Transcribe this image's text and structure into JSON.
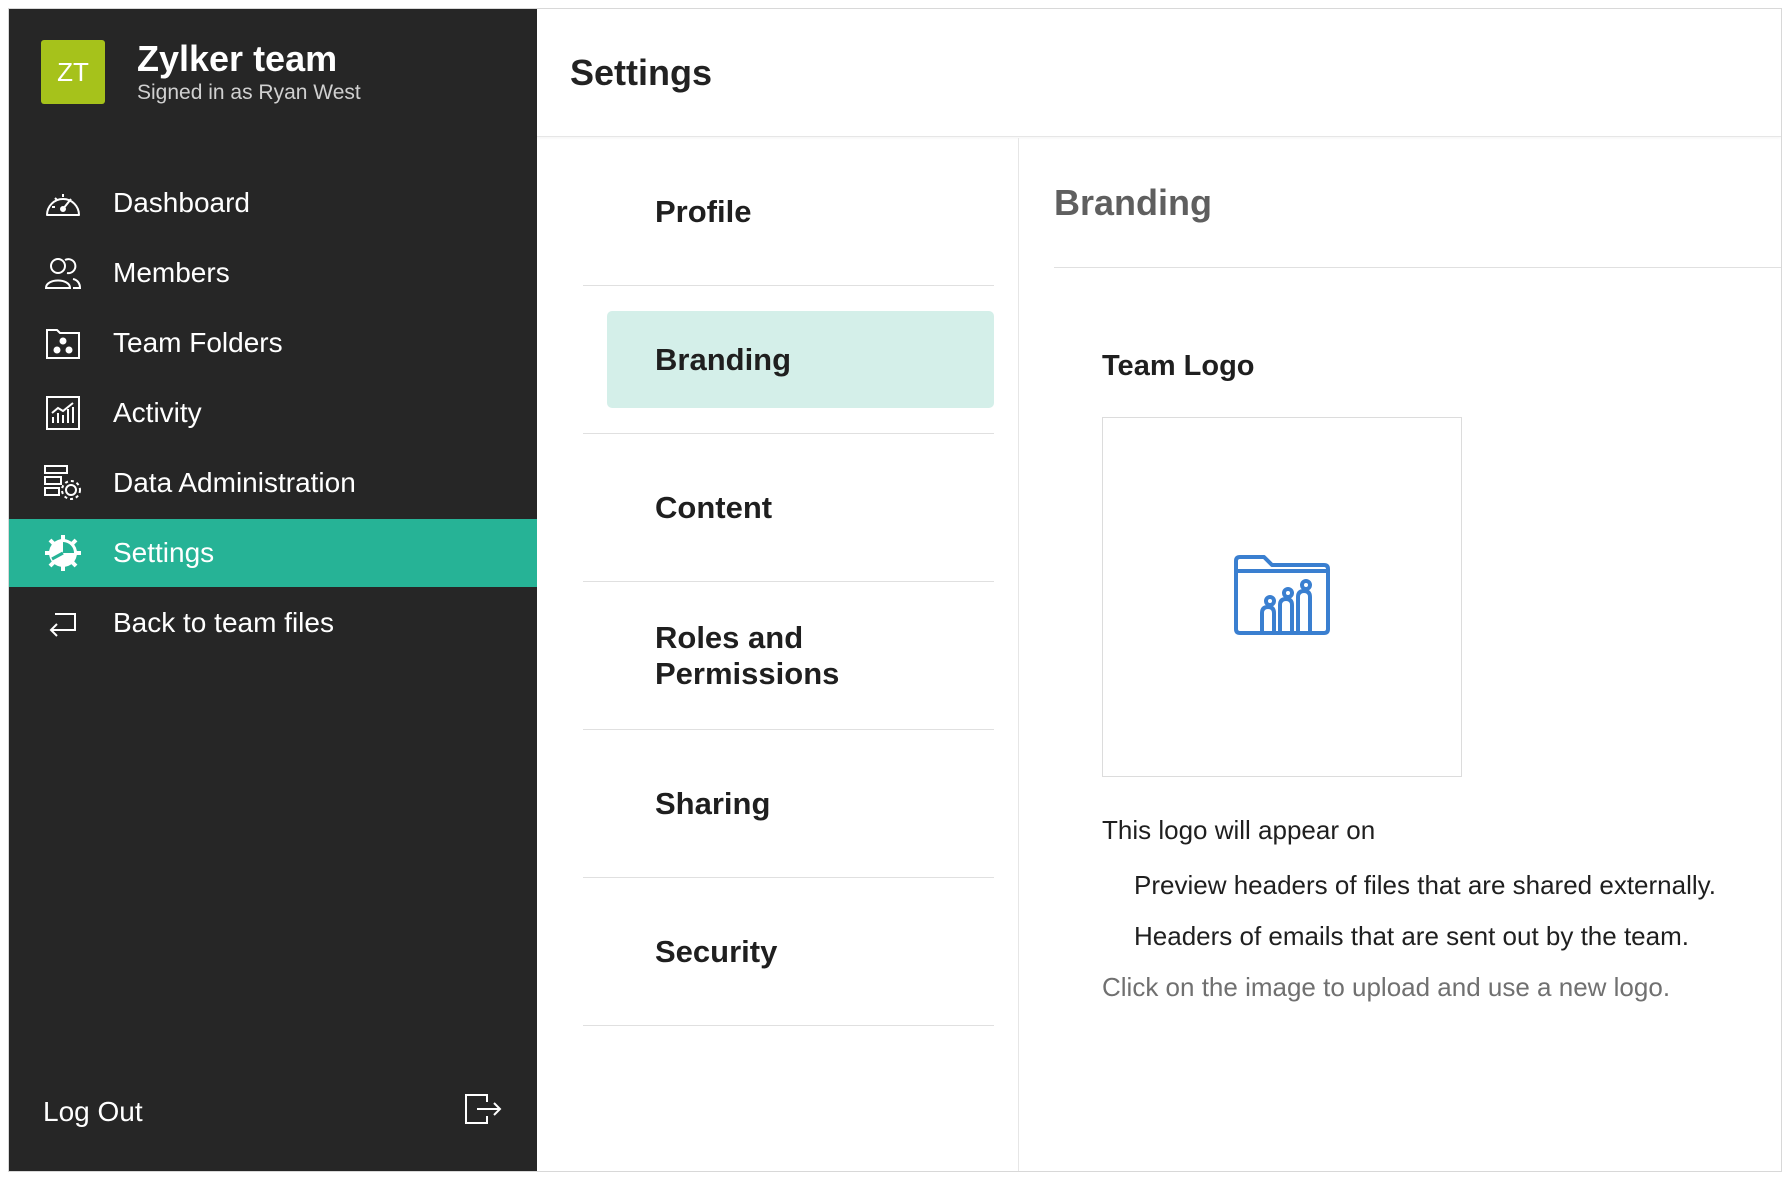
{
  "sidebar": {
    "avatar_initials": "ZT",
    "avatar_color": "#a6c21b",
    "team_name": "Zylker team",
    "signed_in": "Signed in as Ryan West",
    "items": [
      {
        "label": "Dashboard",
        "icon": "dashboard-gauge-icon"
      },
      {
        "label": "Members",
        "icon": "members-icon"
      },
      {
        "label": "Team Folders",
        "icon": "team-folders-icon"
      },
      {
        "label": "Activity",
        "icon": "activity-chart-icon"
      },
      {
        "label": "Data Administration",
        "icon": "data-admin-gear-icon"
      },
      {
        "label": "Settings",
        "icon": "settings-gear-icon",
        "active": true
      },
      {
        "label": "Back to team files",
        "icon": "back-arrow-icon"
      }
    ],
    "logout_label": "Log Out",
    "active_color": "#26b396"
  },
  "header": {
    "title": "Settings"
  },
  "settings_nav": {
    "items": [
      {
        "label": "Profile"
      },
      {
        "label": "Branding",
        "active": true
      },
      {
        "label": "Content"
      },
      {
        "label": "Roles and Permissions"
      },
      {
        "label": "Sharing"
      },
      {
        "label": "Security"
      }
    ]
  },
  "branding": {
    "title": "Branding",
    "team_logo_heading": "Team Logo",
    "appear_intro": "This logo will appear on",
    "appear_items": [
      "Preview headers of files that are shared externally.",
      "Headers of emails that are sent out by the team."
    ],
    "hint": "Click on the image to upload and use a new logo.",
    "logo_icon": "team-folder-logo-icon",
    "logo_color": "#3a7fd0"
  }
}
